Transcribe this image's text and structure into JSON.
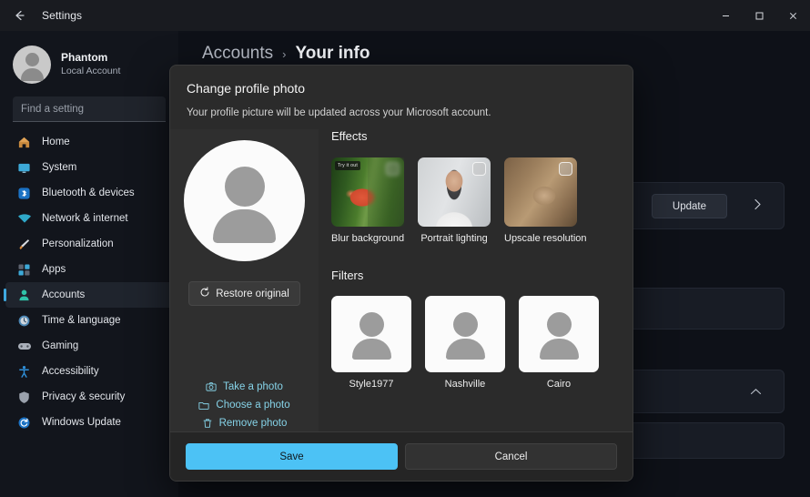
{
  "titlebar": {
    "back_icon": "arrow-left-icon",
    "title": "Settings",
    "minimize_label": "—",
    "maximize_label": "□",
    "close_label": "✕"
  },
  "sidebar": {
    "profile": {
      "name": "Phantom",
      "account_type": "Local Account",
      "avatar_icon": "person-avatar"
    },
    "search": {
      "placeholder": "Find a setting",
      "value": ""
    },
    "items": [
      {
        "label": "Home",
        "icon": "home-icon",
        "selected": false
      },
      {
        "label": "System",
        "icon": "monitor-icon",
        "selected": false
      },
      {
        "label": "Bluetooth & devices",
        "icon": "bluetooth-icon",
        "selected": false
      },
      {
        "label": "Network & internet",
        "icon": "wifi-icon",
        "selected": false
      },
      {
        "label": "Personalization",
        "icon": "brush-icon",
        "selected": false
      },
      {
        "label": "Apps",
        "icon": "apps-icon",
        "selected": false
      },
      {
        "label": "Accounts",
        "icon": "person-icon",
        "selected": true
      },
      {
        "label": "Time & language",
        "icon": "clock-icon",
        "selected": false
      },
      {
        "label": "Gaming",
        "icon": "gamepad-icon",
        "selected": false
      },
      {
        "label": "Accessibility",
        "icon": "accessibility-icon",
        "selected": false
      },
      {
        "label": "Privacy & security",
        "icon": "shield-icon",
        "selected": false
      },
      {
        "label": "Windows Update",
        "icon": "update-icon",
        "selected": false
      }
    ]
  },
  "breadcrumb": {
    "parent": "Accounts",
    "separator": "›",
    "current": "Your info"
  },
  "background": {
    "update_button": "Update",
    "chevron_right_icon": "chevron-right-icon",
    "chevron_up_icon": "chevron-up-icon"
  },
  "dialog": {
    "title": "Change profile photo",
    "subtitle": "Your profile picture will be updated across your Microsoft account.",
    "preview": {
      "avatar_icon": "person-avatar",
      "restore_label": "Restore original",
      "restore_icon": "restore-icon"
    },
    "links": [
      {
        "label": "Take a photo",
        "icon": "camera-icon"
      },
      {
        "label": "Choose a photo",
        "icon": "folder-icon"
      },
      {
        "label": "Remove photo",
        "icon": "trash-icon"
      }
    ],
    "effects": {
      "heading": "Effects",
      "items": [
        {
          "label": "Blur background",
          "thumb": "flamingo-photo",
          "badge": "Try it out",
          "checked": false
        },
        {
          "label": "Portrait lighting",
          "thumb": "portrait-photo",
          "badge": "",
          "checked": false
        },
        {
          "label": "Upscale resolution",
          "thumb": "cat-photo",
          "badge": "",
          "checked": false
        }
      ]
    },
    "filters": {
      "heading": "Filters",
      "items": [
        {
          "label": "Style1977",
          "thumb": "person-avatar"
        },
        {
          "label": "Nashville",
          "thumb": "person-avatar"
        },
        {
          "label": "Cairo",
          "thumb": "person-avatar"
        }
      ]
    },
    "footer": {
      "save_label": "Save",
      "cancel_label": "Cancel",
      "accent_color": "#4cc2f5"
    }
  }
}
